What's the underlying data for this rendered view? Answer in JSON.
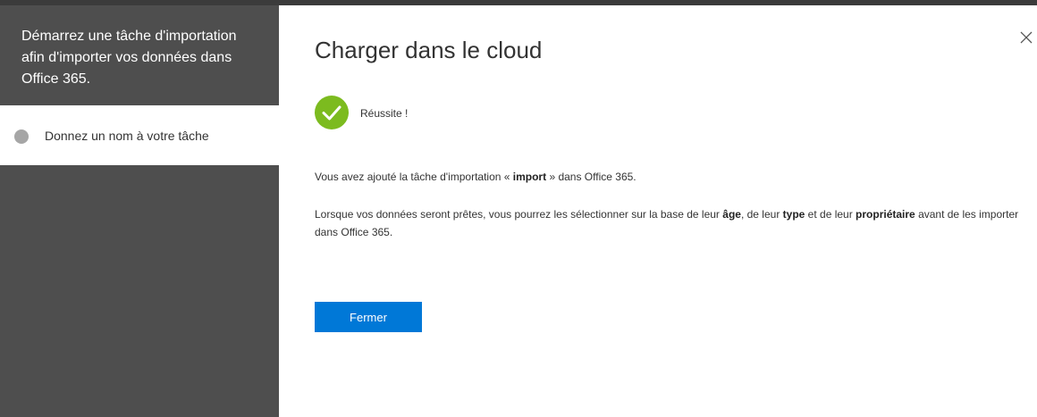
{
  "sidebar": {
    "title": "Démarrez une tâche d'importation afin d'importer vos données dans Office 365.",
    "step_label": "Donnez un nom à votre tâche"
  },
  "main": {
    "title": "Charger dans le cloud",
    "status": "Réussite !",
    "msg1": {
      "pre": "Vous avez ajouté la tâche d'importation « ",
      "name": "import",
      "post": " » dans Office 365."
    },
    "msg2": {
      "part1": "Lorsque vos données seront prêtes, vous pourrez les sélectionner sur la base de leur ",
      "b1": "âge",
      "part2": ", de leur ",
      "b2": "type",
      "part3": " et de leur ",
      "b3": "propriétaire",
      "part4": " avant de les importer dans Office 365."
    },
    "close_button": "Fermer"
  },
  "icons": {
    "close": "close-icon",
    "success": "checkmark-circle-icon",
    "step": "step-dot-icon"
  },
  "colors": {
    "sidebar_bg": "#4e4e4e",
    "success_green": "#7cbb1f",
    "primary_button": "#0078d7"
  }
}
